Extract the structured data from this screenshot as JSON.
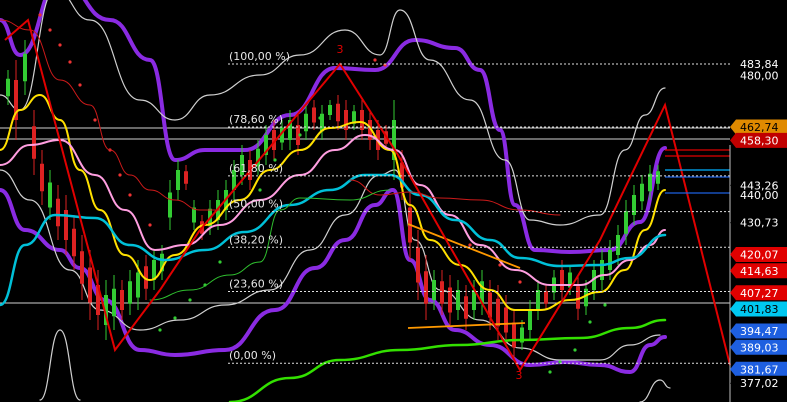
{
  "chart_data": {
    "type": "line",
    "ylim": [
      377,
      490
    ],
    "y_axis_ticks": [
      {
        "text": "483,84",
        "value": 483.84
      },
      {
        "text": "480,00",
        "value": 480.0
      },
      {
        "text": "440,00",
        "value": 440.0
      }
    ],
    "fibonacci_levels": [
      {
        "label": "(100,00 %)",
        "value": 483.84
      },
      {
        "label": "(78,60 %)",
        "value": 462.74
      },
      {
        "label": "(61,80 %)",
        "value": 446.38
      },
      {
        "label": "(50,00 %)",
        "value": 434.45
      },
      {
        "label": "(38,20 %)",
        "value": 422.5
      },
      {
        "label": "(23,60 %)",
        "value": 407.7
      },
      {
        "label": "(0,00 %)",
        "value": 383.7
      }
    ],
    "price_tags": [
      {
        "text": "462,74",
        "value": 462.74,
        "bg": "#e08a00",
        "fg": "#000000"
      },
      {
        "text": "458,30",
        "value": 458.3,
        "bg": "#c00000",
        "fg": "#ffffff"
      },
      {
        "text": "443,26",
        "value": 443.26,
        "bg": "#000000",
        "fg": "#ffffff"
      },
      {
        "text": "430,73",
        "value": 430.73,
        "bg": "#000000",
        "fg": "#ffffff"
      },
      {
        "text": "420,07",
        "value": 420.07,
        "bg": "#e00000",
        "fg": "#ffffff"
      },
      {
        "text": "414,63",
        "value": 414.63,
        "bg": "#e00000",
        "fg": "#ffffff"
      },
      {
        "text": "407,27",
        "value": 407.27,
        "bg": "#e00000",
        "fg": "#ffffff"
      },
      {
        "text": "401,83",
        "value": 401.83,
        "bg": "#00c8f0",
        "fg": "#000000"
      },
      {
        "text": "394,47",
        "value": 394.47,
        "bg": "#1e5fe0",
        "fg": "#ffffff"
      },
      {
        "text": "389,03",
        "value": 389.03,
        "bg": "#1e5fe0",
        "fg": "#ffffff"
      },
      {
        "text": "381,67",
        "value": 381.67,
        "bg": "#1e5fe0",
        "fg": "#ffffff"
      },
      {
        "text": "377,02",
        "value": 377.02,
        "bg": "#000000",
        "fg": "#ffffff"
      }
    ],
    "wave_labels": [
      {
        "text": "3",
        "value": 487.5
      },
      {
        "text": "3",
        "value": 378.5
      }
    ],
    "colors": {
      "bollinger_outer": "#8a2be2",
      "bollinger_inner": "#d0d0d0",
      "ma_yellow": "#ffe000",
      "ma_pink": "#ff9ee0",
      "ma_cyan": "#00c0d8",
      "ma_green": "#33e000",
      "zigzag": "#e00000",
      "trend_orange": "#ff9900",
      "candle_up": "#33cc33",
      "candle_down": "#dd2222"
    }
  }
}
